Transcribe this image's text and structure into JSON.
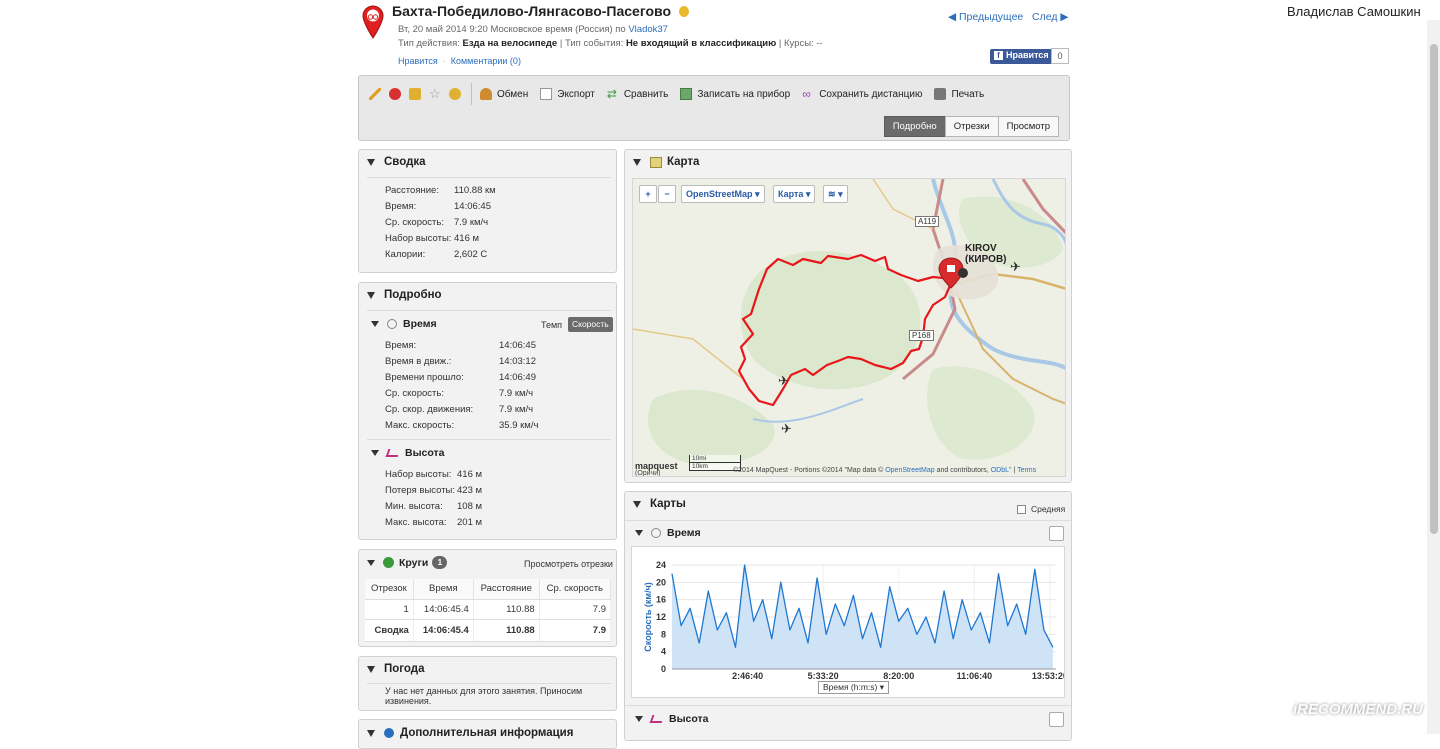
{
  "header": {
    "title": "Бахта-Победилово-Лянгасово-Пасегово",
    "date_line": "Вт, 20 май 2014 9:20 Московское время (Россия) по",
    "author": "Vladok37",
    "activity_type_label": "Тип действия:",
    "activity_type": "Езда на велосипеде",
    "event_type_label": "Тип события:",
    "event_type": "Не входящий в классификацию",
    "courses_label": "Курсы:",
    "courses": "--",
    "like_link": "Нравится",
    "comments_link": "Комментарии (0)",
    "prev_link": "Предыдущее",
    "next_link": "След",
    "fb_like": "Нравится",
    "fb_count": "0"
  },
  "user": {
    "name": "Владислав Самошкин"
  },
  "toolbar": {
    "items": [
      "Обмен",
      "Экспорт",
      "Сравнить",
      "Записать на прибор",
      "Сохранить дистанцию",
      "Печать"
    ],
    "views": [
      "Подробно",
      "Отрезки",
      "Просмотр"
    ],
    "active_view": "Подробно"
  },
  "summary": {
    "title": "Сводка",
    "rows": [
      {
        "label": "Расстояние:",
        "value": "110.88 км"
      },
      {
        "label": "Время:",
        "value": "14:06:45"
      },
      {
        "label": "Ср. скорость:",
        "value": "7.9 км/ч"
      },
      {
        "label": "Набор высоты:",
        "value": "416 м"
      },
      {
        "label": "Калории:",
        "value": "2,602 C"
      }
    ]
  },
  "details": {
    "title": "Подробно",
    "time_section": {
      "title": "Время",
      "toggle": [
        "Темп",
        "Скорость"
      ],
      "active_toggle": "Скорость",
      "rows": [
        {
          "label": "Время:",
          "value": "14:06:45"
        },
        {
          "label": "Время в движ.:",
          "value": "14:03:12"
        },
        {
          "label": "Времени прошло:",
          "value": "14:06:49"
        },
        {
          "label": "Ср. скорость:",
          "value": "7.9 км/ч"
        },
        {
          "label": "Ср. скор. движения:",
          "value": "7.9 км/ч"
        },
        {
          "label": "Макс. скорость:",
          "value": "35.9 км/ч"
        }
      ]
    },
    "elevation_section": {
      "title": "Высота",
      "rows": [
        {
          "label": "Набор высоты:",
          "value": "416 м"
        },
        {
          "label": "Потеря высоты:",
          "value": "423 м"
        },
        {
          "label": "Мин. высота:",
          "value": "108 м"
        },
        {
          "label": "Макс. высота:",
          "value": "201 м"
        }
      ]
    }
  },
  "laps": {
    "title": "Круги",
    "count": "1",
    "view_link": "Просмотреть отрезки",
    "columns": [
      "Отрезок",
      "Время",
      "Расстояние",
      "Ср. скорость"
    ],
    "rows": [
      [
        "1",
        "14:06:45.4",
        "110.88",
        "7.9"
      ]
    ],
    "total": [
      "Сводка",
      "14:06:45.4",
      "110.88",
      "7.9"
    ]
  },
  "weather": {
    "title": "Погода",
    "text_line1": "У нас нет данных для этого занятия. Приносим",
    "text_line2": "извинения."
  },
  "extra": {
    "title": "Дополнительная информация"
  },
  "map": {
    "title": "Карта",
    "provider": "OpenStreetMap",
    "map_type": "Карта",
    "zoom_in": "+",
    "zoom_out": "−",
    "city_label_1": "KIROV",
    "city_label_2": "(КИРОВ)",
    "road_a119": "A119",
    "road_p168": "P168",
    "scale_mi": "10mi",
    "scale_km": "10km",
    "logo": "mapquest",
    "logo_sub": "(Оричи)",
    "attribution_1": "©2014 MapQuest - Portions ©2014 \"Map data ©",
    "attribution_osm": "OpenStreetMap",
    "attribution_2": "and contributors,",
    "attribution_odbl": "ODbL\"",
    "attribution_terms": "Terms",
    "route_color": "#e8161b"
  },
  "charts": {
    "title": "Карты",
    "average_label": "Средняя",
    "time_title": "Время",
    "elevation_title": "Высота",
    "xaxis_select": "Время (h:m:s)"
  },
  "chart_data": {
    "type": "area",
    "title": "",
    "xlabel": "Время (h:m:s)",
    "ylabel": "Скорость (км/ч)",
    "ylim": [
      0,
      24
    ],
    "yticks": [
      0,
      4,
      8,
      12,
      16,
      20,
      24
    ],
    "xticks": [
      "2:46:40",
      "5:33:20",
      "8:20:00",
      "11:06:40",
      "13:53:20"
    ],
    "xlim": [
      "0:00:00",
      "14:06:45"
    ],
    "grid": true,
    "color": "#1f77d0",
    "fill": "#cfe3f7",
    "series": [
      {
        "x": [
          "0:00:00",
          "0:20:00",
          "0:40:00",
          "1:00:00",
          "1:20:00",
          "1:40:00",
          "2:00:00",
          "2:20:00",
          "2:40:00",
          "3:00:00",
          "3:20:00",
          "3:40:00",
          "4:00:00",
          "4:20:00",
          "4:40:00",
          "5:00:00",
          "5:20:00",
          "5:40:00",
          "6:00:00",
          "6:20:00",
          "6:40:00",
          "7:00:00",
          "7:20:00",
          "7:40:00",
          "8:00:00",
          "8:20:00",
          "8:40:00",
          "9:00:00",
          "9:20:00",
          "9:40:00",
          "10:00:00",
          "10:20:00",
          "10:40:00",
          "11:00:00",
          "11:20:00",
          "11:40:00",
          "12:00:00",
          "12:20:00",
          "12:40:00",
          "13:00:00",
          "13:20:00",
          "13:40:00",
          "14:00:00"
        ],
        "values": [
          22,
          10,
          14,
          6,
          18,
          9,
          13,
          5,
          24,
          11,
          16,
          7,
          20,
          9,
          14,
          6,
          21,
          8,
          15,
          10,
          17,
          7,
          13,
          5,
          19,
          11,
          14,
          8,
          12,
          6,
          18,
          7,
          16,
          9,
          13,
          6,
          22,
          10,
          15,
          8,
          23,
          9,
          5
        ]
      }
    ]
  }
}
